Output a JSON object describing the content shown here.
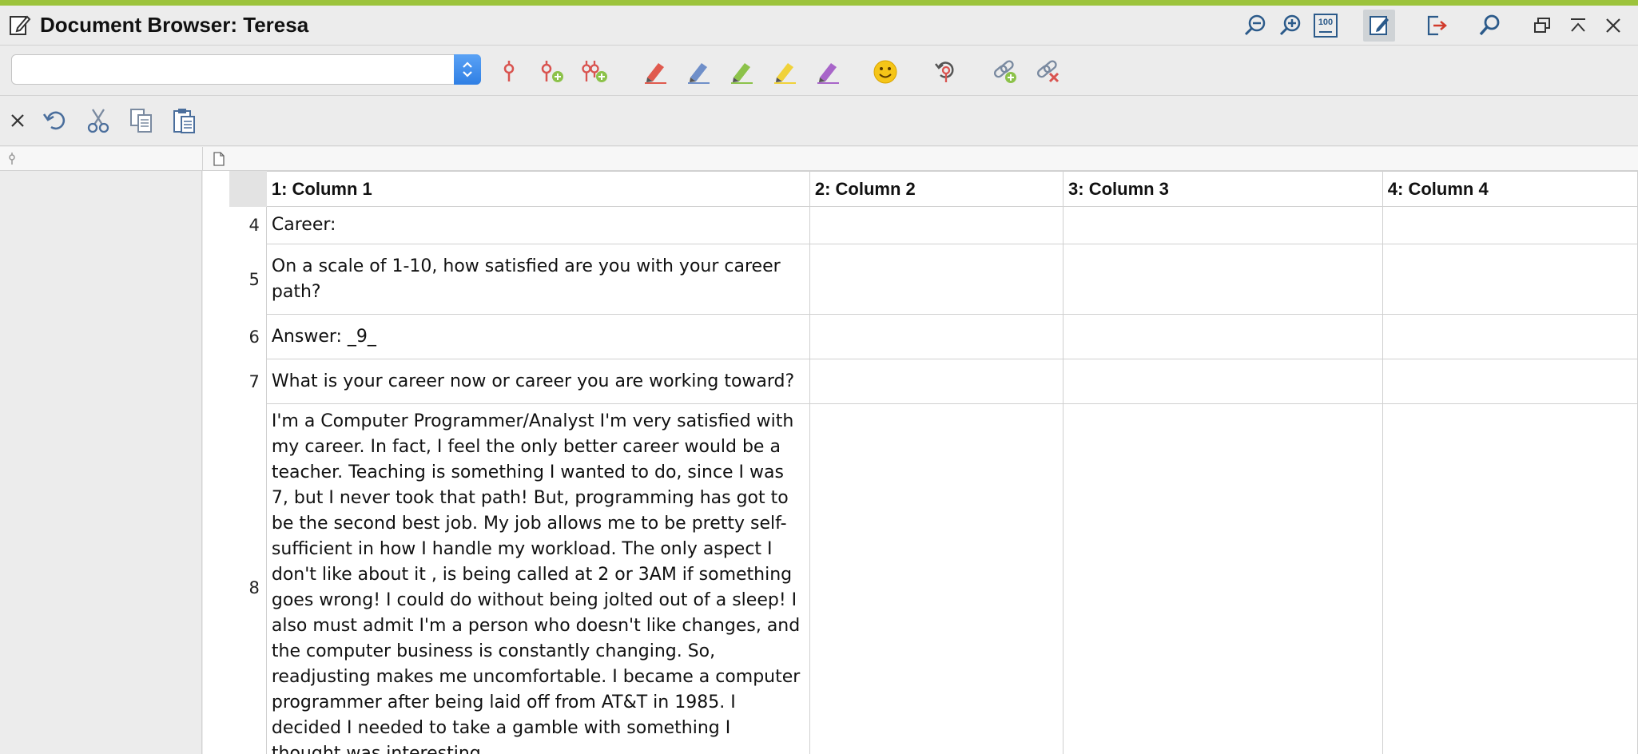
{
  "window": {
    "title": "Document Browser: Teresa",
    "accent_color": "#9cc33c"
  },
  "window_controls": [
    {
      "name": "zoom-out-icon"
    },
    {
      "name": "zoom-in-icon"
    },
    {
      "name": "zoom-100-icon",
      "label": "100"
    },
    {
      "name": "edit-mode-icon"
    },
    {
      "name": "export-icon"
    },
    {
      "name": "search-icon"
    },
    {
      "name": "restore-window-icon"
    },
    {
      "name": "minimize-window-icon"
    },
    {
      "name": "close-window-icon"
    }
  ],
  "toolbar1": {
    "code_combo_value": "",
    "icons": [
      "code-pin-icon",
      "code-pin-add-icon",
      "code-pin-multi-add-icon",
      "highlighter-red-icon",
      "highlighter-blue-icon",
      "highlighter-green-icon",
      "highlighter-yellow-icon",
      "highlighter-purple-icon",
      "emoticon-icon",
      "undo-coding-icon",
      "link-add-icon",
      "link-remove-icon"
    ],
    "highlighter_colors": {
      "red": "#e05a4e",
      "blue": "#6f8fc9",
      "green": "#8cc24a",
      "yellow": "#f0d23a",
      "purple": "#a865c9"
    }
  },
  "toolbar2": {
    "icons": [
      "close-icon",
      "undo-icon",
      "cut-icon",
      "copy-icon",
      "paste-icon"
    ]
  },
  "table": {
    "columns": [
      "1: Column 1",
      "2: Column 2",
      "3: Column 3",
      "4: Column 4"
    ],
    "rows": [
      {
        "num": "4",
        "c1": "Career:"
      },
      {
        "num": "5",
        "c1": "On a scale of 1-10, how satisfied are you with your career path?"
      },
      {
        "num": "6",
        "c1": "Answer: _9_"
      },
      {
        "num": "7",
        "c1": "What is your career now or career you are working toward?"
      },
      {
        "num": "8",
        "c1": "I'm a Computer Programmer/Analyst I'm very satisfied with my career.  In fact, I feel the only better career would be a teacher.  Teaching is something I wanted to do, since I was 7, but I never took that path!  But, programming has got to be the second best job.  My job allows me to be pretty self-sufficient in how I handle my workload.  The only aspect I don't like about it , is being called at 2 or 3AM  if something goes wrong!  I could do without being jolted out of a sleep!  I also must admit I'm a person who doesn't like changes, and the computer business is constantly changing.  So, readjusting makes me uncomfortable.  I became a computer programmer after being laid off from AT&T in 1985.  I decided I needed to take a gamble with something I thought was interesting."
      }
    ]
  }
}
